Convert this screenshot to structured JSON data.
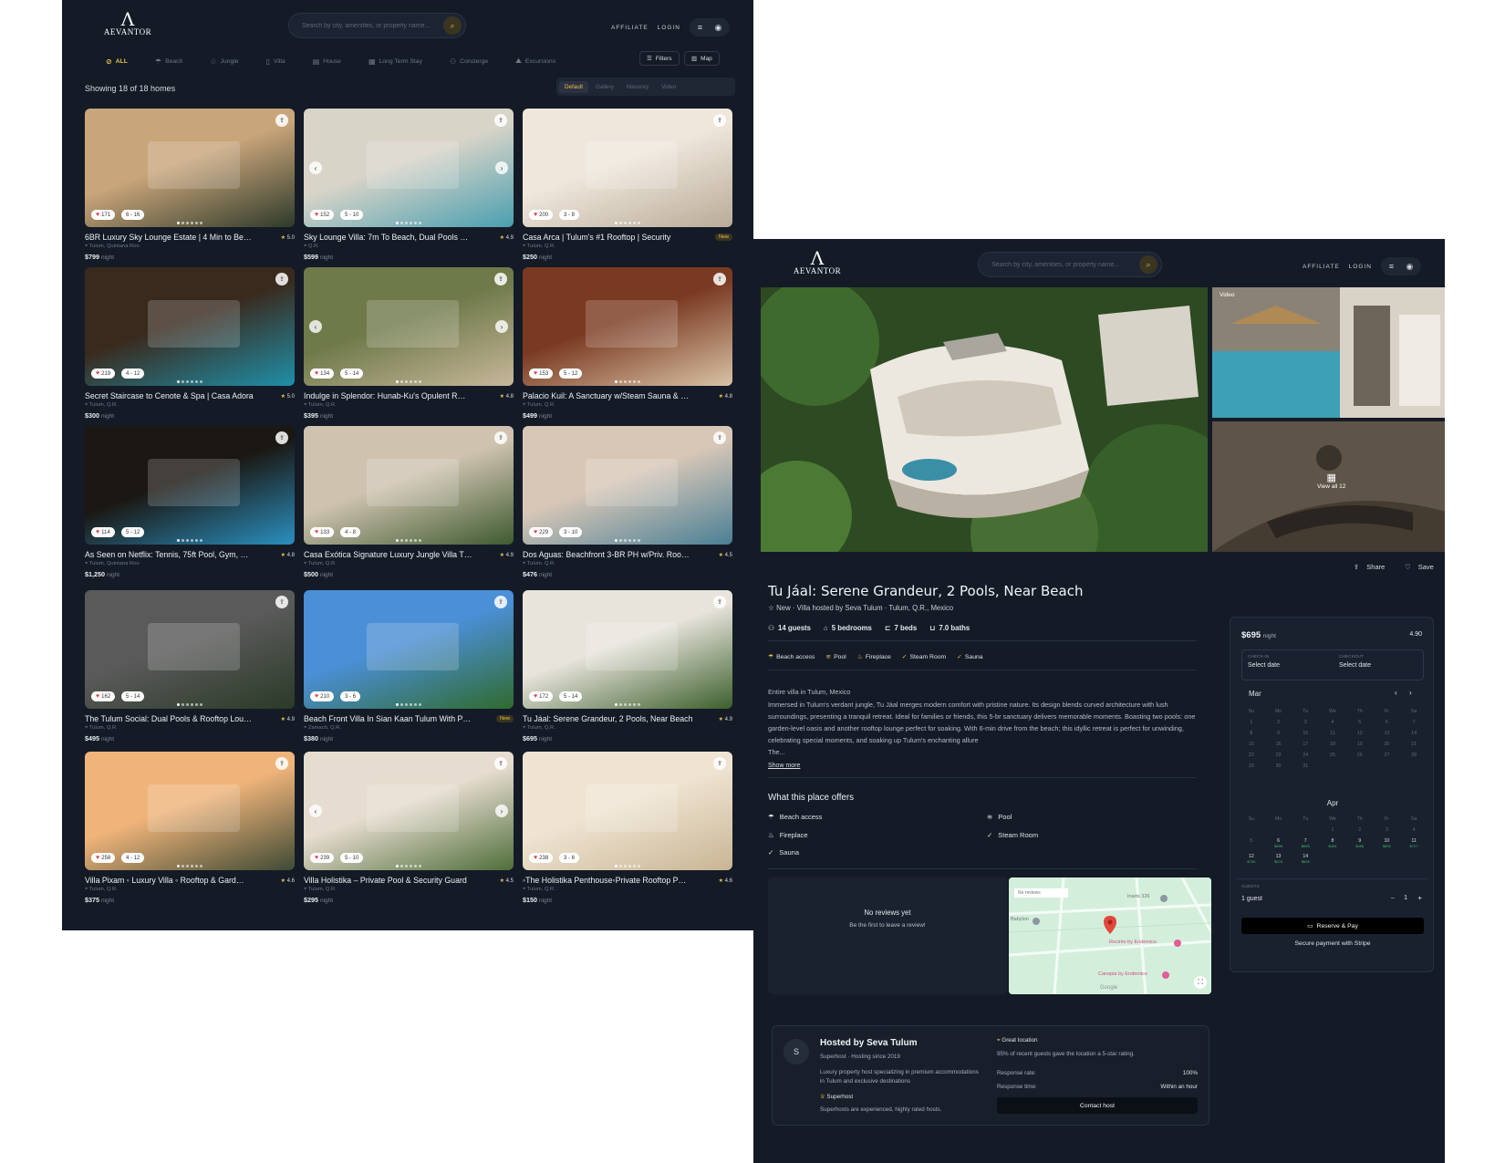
{
  "brand": {
    "mark": "Λ",
    "name": "AEVANTOR"
  },
  "header": {
    "search_placeholder": "Search by city, amenities, or property name...",
    "affiliate": "AFFILIATE",
    "login": "LOGIN"
  },
  "categories": [
    "ALL",
    "Beach",
    "Jungle",
    "Villa",
    "House",
    "Long Term Stay",
    "Concierge",
    "Excursions"
  ],
  "toolbar": {
    "filters": "Filters",
    "map": "Map"
  },
  "listing": {
    "showing": "Showing 18 of 18 homes",
    "views": [
      "Default",
      "Gallery",
      "Masonry",
      "Video"
    ]
  },
  "cards": [
    {
      "title": "6BR Luxury Sky Lounge Estate | 4 Min to Be…",
      "rating": "5.0",
      "loc": "Tulum, Quintana Roo",
      "price": "$799",
      "likes": "171",
      "beds": "6 - 16",
      "c1": "#c9a57a",
      "c2": "#2e3a2a"
    },
    {
      "title": "Sky Lounge Villa: 7m To Beach, Dual Pools …",
      "rating": "4.9",
      "loc": "Q.R.",
      "price": "$599",
      "likes": "152",
      "beds": "5 - 10",
      "c1": "#d9d4c8",
      "c2": "#4a9fb0"
    },
    {
      "title": "Casa Arca | Tulum's #1 Rooftop | Security",
      "rating": "New",
      "loc": "Tulum, Q.R.",
      "price": "$250",
      "likes": "200",
      "beds": "3 - 8",
      "c1": "#efe7dc",
      "c2": "#b9ab98"
    },
    {
      "title": "Secret Staircase to Cenote & Spa | Casa Adora",
      "rating": "5.0",
      "loc": "Tulum, Q.R.",
      "price": "$300",
      "likes": "219",
      "beds": "4 - 12",
      "c1": "#3a2a1e",
      "c2": "#1f8fa8"
    },
    {
      "title": "Indulge in Splendor: Hunab-Ku's Opulent R…",
      "rating": "4.8",
      "loc": "Tulum, Q.R.",
      "price": "$395",
      "likes": "134",
      "beds": "5 - 14",
      "c1": "#6f7a4a",
      "c2": "#c7b79a"
    },
    {
      "title": "Palacio Kuil: A Sanctuary w/Steam Sauna & …",
      "rating": "4.8",
      "loc": "Tulum, Q.R.",
      "price": "$499",
      "likes": "153",
      "beds": "5 - 12",
      "c1": "#7a3a22",
      "c2": "#d9c3a5"
    },
    {
      "title": "As Seen on Netflix: Tennis, 75ft Pool, Gym, …",
      "rating": "4.8",
      "loc": "Tulum, Quintana Roo",
      "price": "$1,250",
      "likes": "114",
      "beds": "5 - 12",
      "c1": "#1b1712",
      "c2": "#2a8fbf"
    },
    {
      "title": "Casa Exótica Signature Luxury Jungle Villa T…",
      "rating": "4.9",
      "loc": "Tulum, Q.R.",
      "price": "$500",
      "likes": "133",
      "beds": "4 - 8",
      "c1": "#cfc3b0",
      "c2": "#3e5a30"
    },
    {
      "title": "Dos Aguas: Beachfront 3-BR PH w/Priv. Roo…",
      "rating": "4.5",
      "loc": "Tulum, Q.R.",
      "price": "$476",
      "likes": "229",
      "beds": "3 - 10",
      "c1": "#d8c7b7",
      "c2": "#4a7f95"
    },
    {
      "title": "The Tulum Social: Dual Pools & Rooftop Lou…",
      "rating": "4.9",
      "loc": "Tulum, Q.R.",
      "price": "$495",
      "likes": "162",
      "beds": "5 - 14",
      "c1": "#5a5a5a",
      "c2": "#2b3a28"
    },
    {
      "title": "Beach Front Villa In Sian Kaan Tulum With P…",
      "rating": "New",
      "loc": "Zamach, Q.R.",
      "price": "$380",
      "likes": "210",
      "beds": "3 - 6",
      "c1": "#4b8fd6",
      "c2": "#2f6b2e"
    },
    {
      "title": "Tu Jáal: Serene Grandeur, 2 Pools, Near Beach",
      "rating": "4.9",
      "loc": "Tulum, Q.R.",
      "price": "$695",
      "likes": "172",
      "beds": "5 - 14",
      "c1": "#e8e4dc",
      "c2": "#3c5f2c"
    },
    {
      "title": "Villa Pixam ◦ Luxury Villa ◦ Rooftop & Gard…",
      "rating": "4.6",
      "loc": "Tulum, Q.R.",
      "price": "$375",
      "likes": "258",
      "beds": "4 - 12",
      "c1": "#f0b47a",
      "c2": "#3f4a34"
    },
    {
      "title": "Villa Holistika – Private Pool & Security Guard",
      "rating": "4.5",
      "loc": "Tulum, Q.R.",
      "price": "$295",
      "likes": "239",
      "beds": "5 - 10",
      "c1": "#e6dccf",
      "c2": "#4f6e3a"
    },
    {
      "title": "◦The Holistika Penthouse◦Private Rooftop P…",
      "rating": "4.6",
      "loc": "Tulum, Q.R.",
      "price": "$150",
      "likes": "238",
      "beds": "3 - 6",
      "c1": "#efe4d2",
      "c2": "#c9b594"
    }
  ],
  "card_common": {
    "night": "night"
  },
  "detail": {
    "search_placeholder": "Search by city, amenities, or property name...",
    "video": "Video",
    "view_all": "View all 12",
    "share": "Share",
    "save": "Save",
    "title": "Tu Jáal: Serene Grandeur, 2 Pools, Near Beach",
    "subtitle": "☆ New  ·  Villa hosted by Seva Tulum  ·  Tulum, Q.R., Mexico",
    "stats": [
      "14 guests",
      "5 bedrooms",
      "7 beds",
      "7.0 baths"
    ],
    "tags": [
      "Beach access",
      "Pool",
      "Fireplace",
      "Steam Room",
      "Sauna"
    ],
    "desc_lead": "Entire villa in Tulum, Mexico",
    "desc": "Immersed in Tulum's verdant jungle, Tu Jáal merges modern comfort with pristine nature. Its design blends curved architecture with lush surroundings, presenting a tranquil retreat. Ideal for families or friends, this 5-br sanctuary delivers memorable moments. Boasting two pools: one garden-level oasis and another rooftop lounge perfect for soaking. With 6-min drive from the beach; this idyllic retreat is perfect for unwinding, celebrating special moments, and soaking up Tulum's enchanting allure",
    "desc_tail": "The...",
    "show_more": "Show more",
    "offers_title": "What this place offers",
    "amenities": [
      "Beach access",
      "Pool",
      "Fireplace",
      "Steam Room",
      "Sauna"
    ],
    "no_reviews": "No reviews yet",
    "be_first": "Be the first to leave a review!",
    "map": {
      "no_reviews": "No reviews",
      "l1": "Recinto by Endemico",
      "l2": "Canopia by Endemico",
      "l3": "Babylon",
      "l4": "Inarts 326",
      "google": "Google"
    },
    "host": {
      "initial": "S",
      "name": "Hosted by Seva Tulum",
      "meta": "Superhost · Hosting since 2019",
      "bio": "Luxury property host specializing in premium accommodations in Tulum and exclusive destinations",
      "superhost": "Superhost",
      "superhost_desc": "Superhosts are experienced, highly rated hosts.",
      "great": "Great location",
      "great_desc": "95% of recent guests gave the location a 5-star rating.",
      "rr": "Response rate:",
      "rr_v": "100%",
      "rt": "Response time:",
      "rt_v": "Within an hour",
      "contact": "Contact host"
    },
    "booking": {
      "price": "$695",
      "night": "night",
      "rating": "4.90",
      "checkin": "CHECK-IN",
      "checkout": "CHECKOUT",
      "select": "Select date",
      "m1": "Mar",
      "m2": "Apr",
      "guests_lbl": "GUESTS",
      "guests": "1 guest",
      "count": "1",
      "reserve": "Reserve & Pay",
      "secure": "Secure payment with Stripe",
      "days": [
        "Su",
        "Mo",
        "Tu",
        "We",
        "Th",
        "Fr",
        "Sa"
      ],
      "mar": [
        "1",
        "2",
        "3",
        "4",
        "5",
        "6",
        "7",
        "8",
        "9",
        "10",
        "11",
        "12",
        "13",
        "14",
        "15",
        "16",
        "17",
        "18",
        "19",
        "20",
        "21",
        "22",
        "23",
        "24",
        "25",
        "26",
        "27",
        "28",
        "29",
        "30",
        "31"
      ],
      "apr": [
        "1",
        "2",
        "3",
        "4",
        "5",
        "6",
        "7",
        "8",
        "9",
        "10",
        "11",
        "12",
        "13",
        "14"
      ],
      "apr_prices": {
        "6": "$695",
        "7": "$695",
        "8": "$454",
        "9": "$498",
        "10": "$695",
        "11": "$727",
        "12": "$700",
        "13": "$678",
        "14": "$695"
      }
    }
  }
}
